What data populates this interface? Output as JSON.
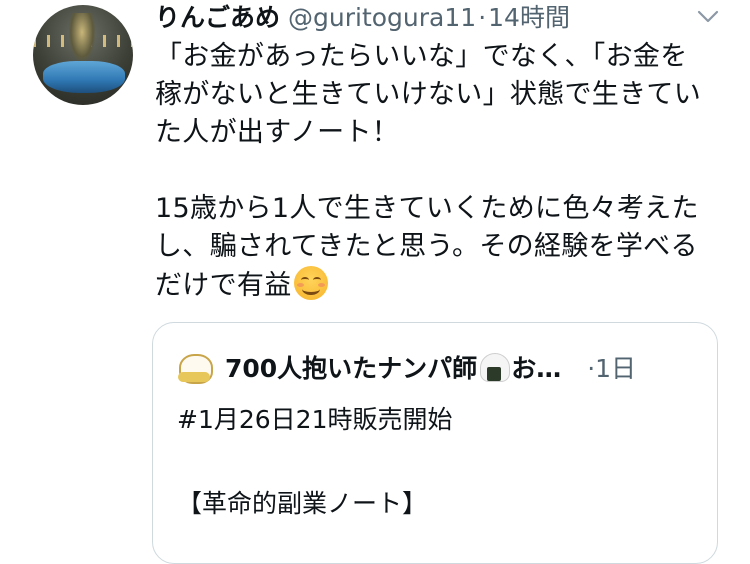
{
  "tweet": {
    "display_name": "りんごあめ",
    "handle": "@guritogura11",
    "separator": "·",
    "time": "14時間",
    "body_lines": [
      "「お金があったらいいな」でなく、「お金を",
      "稼がないと生きていけない」状態で生きてい",
      "た人が出すノート！",
      "15歳から1人で生きていくために色々考えた",
      "し、騙されてきたと思う。その経験を学べる",
      "だけで有益"
    ],
    "emoji_icon": "smiling-face-emoji"
  },
  "quoted_tweet": {
    "display_name": "700人抱いたナンパ師",
    "name_suffix": "お…",
    "name_emoji_icon": "onigiri-emoji",
    "time": "·1日",
    "lines": [
      "#1月26日21時販売開始",
      "【革命的副業ノート】"
    ]
  },
  "icons": {
    "more_menu": "chevron-down-icon"
  },
  "colors": {
    "text": "#0f1419",
    "secondary_text": "#536471",
    "card_border": "#cfd9de"
  }
}
